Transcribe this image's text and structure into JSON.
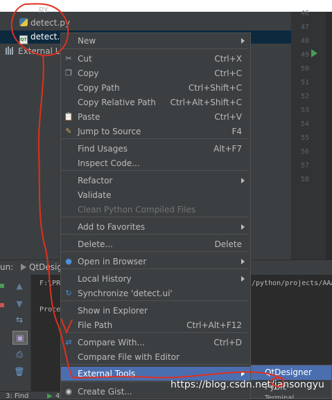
{
  "project_tree": {
    "items": [
      {
        "label": "detect.py",
        "icon": "python-file-icon"
      },
      {
        "label": "detect.u",
        "icon": "ui-file-icon"
      },
      {
        "label": "External Li",
        "icon": "library-icon"
      }
    ],
    "partial_top_label": "py"
  },
  "gutter": {
    "line_numbers": [
      "46",
      "47",
      "48",
      "49",
      "50",
      "51",
      "52",
      "53",
      "54",
      "55",
      "56",
      "57",
      "58"
    ]
  },
  "run_panel": {
    "tab_label": "un:",
    "config_name": "QtDesig",
    "console_lines": [
      "F:\\PR",
      "Proce",
      "/python/projects/AAA"
    ],
    "bottom_tab": "3: Find",
    "bottom_num": "4"
  },
  "context_menu": {
    "items": [
      {
        "label": "New",
        "shortcut": "",
        "submenu": true,
        "icon": ""
      },
      {
        "label": "Cut",
        "shortcut": "Ctrl+X",
        "submenu": false,
        "icon": "scissors-icon"
      },
      {
        "label": "Copy",
        "shortcut": "Ctrl+C",
        "submenu": false,
        "icon": "copy-icon"
      },
      {
        "label": "Copy Path",
        "shortcut": "Ctrl+Shift+C",
        "submenu": false,
        "icon": ""
      },
      {
        "label": "Copy Relative Path",
        "shortcut": "Ctrl+Alt+Shift+C",
        "submenu": false,
        "icon": ""
      },
      {
        "label": "Paste",
        "shortcut": "Ctrl+V",
        "submenu": false,
        "icon": "paste-icon"
      },
      {
        "label": "Jump to Source",
        "shortcut": "F4",
        "submenu": false,
        "icon": "jump-icon"
      },
      {
        "label": "Find Usages",
        "shortcut": "Alt+F7",
        "submenu": false,
        "icon": ""
      },
      {
        "label": "Inspect Code...",
        "shortcut": "",
        "submenu": false,
        "icon": ""
      },
      {
        "label": "Refactor",
        "shortcut": "",
        "submenu": true,
        "icon": ""
      },
      {
        "label": "Validate",
        "shortcut": "",
        "submenu": false,
        "icon": ""
      },
      {
        "label": "Clean Python Compiled Files",
        "shortcut": "",
        "submenu": false,
        "icon": "",
        "disabled": true
      },
      {
        "label": "Add to Favorites",
        "shortcut": "",
        "submenu": true,
        "icon": ""
      },
      {
        "label": "Delete...",
        "shortcut": "Delete",
        "submenu": false,
        "icon": ""
      },
      {
        "label": "Open in Browser",
        "shortcut": "",
        "submenu": true,
        "icon": "globe-icon"
      },
      {
        "label": "Local History",
        "shortcut": "",
        "submenu": true,
        "icon": ""
      },
      {
        "label": "Synchronize 'detect.ui'",
        "shortcut": "",
        "submenu": false,
        "icon": "sync-icon"
      },
      {
        "label": "Show in Explorer",
        "shortcut": "",
        "submenu": false,
        "icon": ""
      },
      {
        "label": "File Path",
        "shortcut": "Ctrl+Alt+F12",
        "submenu": false,
        "icon": ""
      },
      {
        "label": "Compare With...",
        "shortcut": "Ctrl+D",
        "submenu": false,
        "icon": "compare-icon"
      },
      {
        "label": "Compare File with Editor",
        "shortcut": "",
        "submenu": false,
        "icon": ""
      },
      {
        "label": "External Tools",
        "shortcut": "",
        "submenu": true,
        "icon": "",
        "highlighted": true
      },
      {
        "label": "Create Gist...",
        "shortcut": "",
        "submenu": false,
        "icon": "github-icon"
      }
    ]
  },
  "submenu": {
    "items": [
      {
        "label": "QtDesigner"
      },
      {
        "label": "Pyuic"
      },
      {
        "label": "Terminal"
      }
    ]
  },
  "watermark": "https://blog.csdn.net/jansongyu",
  "colors": {
    "menu_bg": "#3c3f41",
    "highlight": "#4b6eaf",
    "annotation": "#e0301e"
  }
}
